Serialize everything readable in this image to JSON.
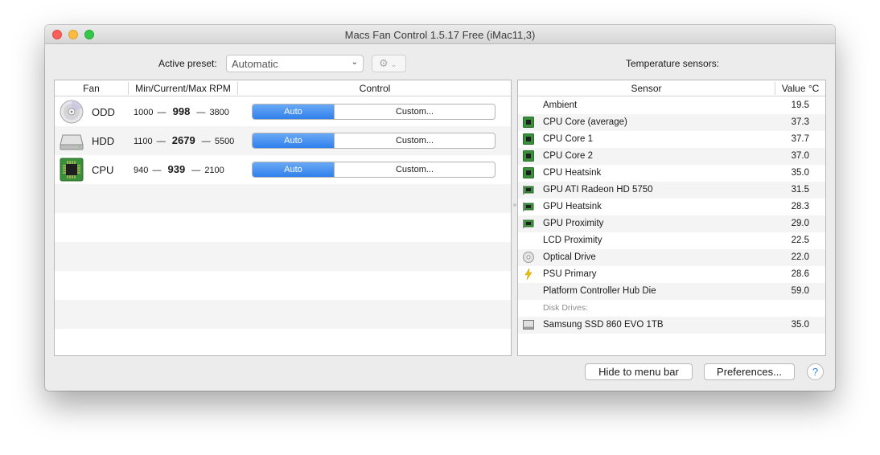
{
  "window": {
    "title": "Macs Fan Control 1.5.17 Free (iMac11,3)"
  },
  "preset": {
    "label": "Active preset:",
    "value": "Automatic"
  },
  "fans_header": {
    "fan": "Fan",
    "rpm": "Min/Current/Max RPM",
    "control": "Control"
  },
  "fans": [
    {
      "name": "ODD",
      "icon": "optical-drive-icon",
      "min": "1000",
      "current": "998",
      "max": "3800",
      "auto_label": "Auto",
      "custom_label": "Custom..."
    },
    {
      "name": "HDD",
      "icon": "hard-drive-icon",
      "min": "1100",
      "current": "2679",
      "max": "5500",
      "auto_label": "Auto",
      "custom_label": "Custom..."
    },
    {
      "name": "CPU",
      "icon": "cpu-chip-icon",
      "min": "940",
      "current": "939",
      "max": "2100",
      "auto_label": "Auto",
      "custom_label": "Custom..."
    }
  ],
  "sensors_title": "Temperature sensors:",
  "sensors_header": {
    "sensor": "Sensor",
    "value": "Value °C"
  },
  "sensors": [
    {
      "name": "Ambient",
      "value": "19.5",
      "icon": "none"
    },
    {
      "name": "CPU Core (average)",
      "value": "37.3",
      "icon": "cpu-chip-icon"
    },
    {
      "name": "CPU Core 1",
      "value": "37.7",
      "icon": "cpu-chip-icon"
    },
    {
      "name": "CPU Core 2",
      "value": "37.0",
      "icon": "cpu-chip-icon"
    },
    {
      "name": "CPU Heatsink",
      "value": "35.0",
      "icon": "cpu-chip-icon"
    },
    {
      "name": "GPU ATI Radeon HD 5750",
      "value": "31.5",
      "icon": "gpu-card-icon"
    },
    {
      "name": "GPU Heatsink",
      "value": "28.3",
      "icon": "gpu-card-icon"
    },
    {
      "name": "GPU Proximity",
      "value": "29.0",
      "icon": "gpu-card-icon"
    },
    {
      "name": "LCD Proximity",
      "value": "22.5",
      "icon": "none"
    },
    {
      "name": "Optical Drive",
      "value": "22.0",
      "icon": "optical-drive-icon"
    },
    {
      "name": "PSU Primary",
      "value": "28.6",
      "icon": "lightning-icon"
    },
    {
      "name": "Platform Controller Hub Die",
      "value": "59.0",
      "icon": "none"
    }
  ],
  "disk_section_label": "Disk Drives:",
  "disks": [
    {
      "name": "Samsung SSD 860 EVO 1TB",
      "value": "35.0",
      "icon": "ssd-drive-icon"
    }
  ],
  "buttons": {
    "hide": "Hide to menu bar",
    "preferences": "Preferences...",
    "help": "?"
  },
  "colors": {
    "accent": "#2f80ed",
    "chip_green": "#3a8f3a"
  }
}
